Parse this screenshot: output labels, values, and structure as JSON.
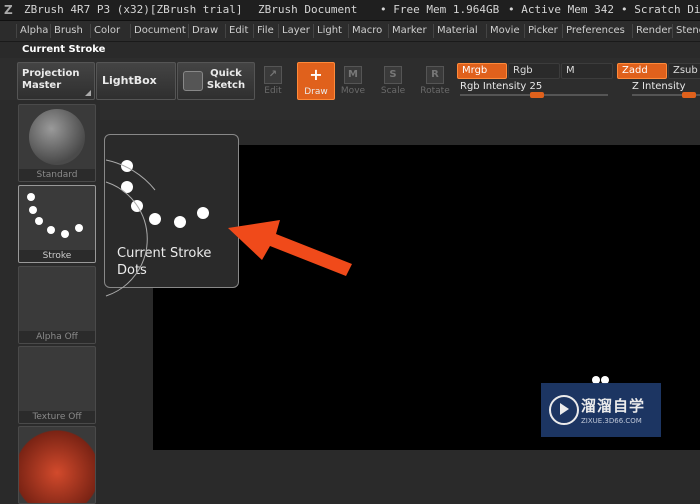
{
  "titlebar": {
    "app": "ZBrush 4R7 P3 (x32)[ZBrush trial]",
    "doc": "ZBrush Document",
    "free_mem": "• Free Mem 1.964GB",
    "active_mem": "• Active Mem 342",
    "scratch": "• Scratch Dis"
  },
  "menu": [
    "Alpha",
    "Brush",
    "Color",
    "Document",
    "Draw",
    "Edit",
    "File",
    "Layer",
    "Light",
    "Macro",
    "Marker",
    "Material",
    "Movie",
    "Picker",
    "Preferences",
    "Render",
    "Stenc"
  ],
  "palette_title": "Current Stroke",
  "toolbar": {
    "projection_master": "Projection Master",
    "lightbox": "LightBox",
    "quick_sketch": "Quick Sketch",
    "edit": "Edit",
    "draw": "Draw",
    "move": "Move",
    "scale": "Scale",
    "rotate": "Rotate",
    "mrgb": "Mrgb",
    "rgb": "Rgb",
    "m": "M",
    "zadd": "Zadd",
    "zsub": "Zsub",
    "rgb_intensity": "Rgb Intensity 25",
    "z_intensity": "Z Intensity",
    "rgb_intensity_value": 25
  },
  "shelf": {
    "standard": "Standard",
    "stroke": "Stroke",
    "alpha": "Alpha Off",
    "texture": "Texture Off"
  },
  "popup": {
    "line1": "Current Stroke",
    "line2": "Dots"
  },
  "watermark": {
    "text": "溜溜自学",
    "url": "ZIXUE.3D66.COM"
  },
  "colors": {
    "accent": "#e0611c",
    "arrow": "#f04a1a",
    "canvas": "#000000"
  }
}
